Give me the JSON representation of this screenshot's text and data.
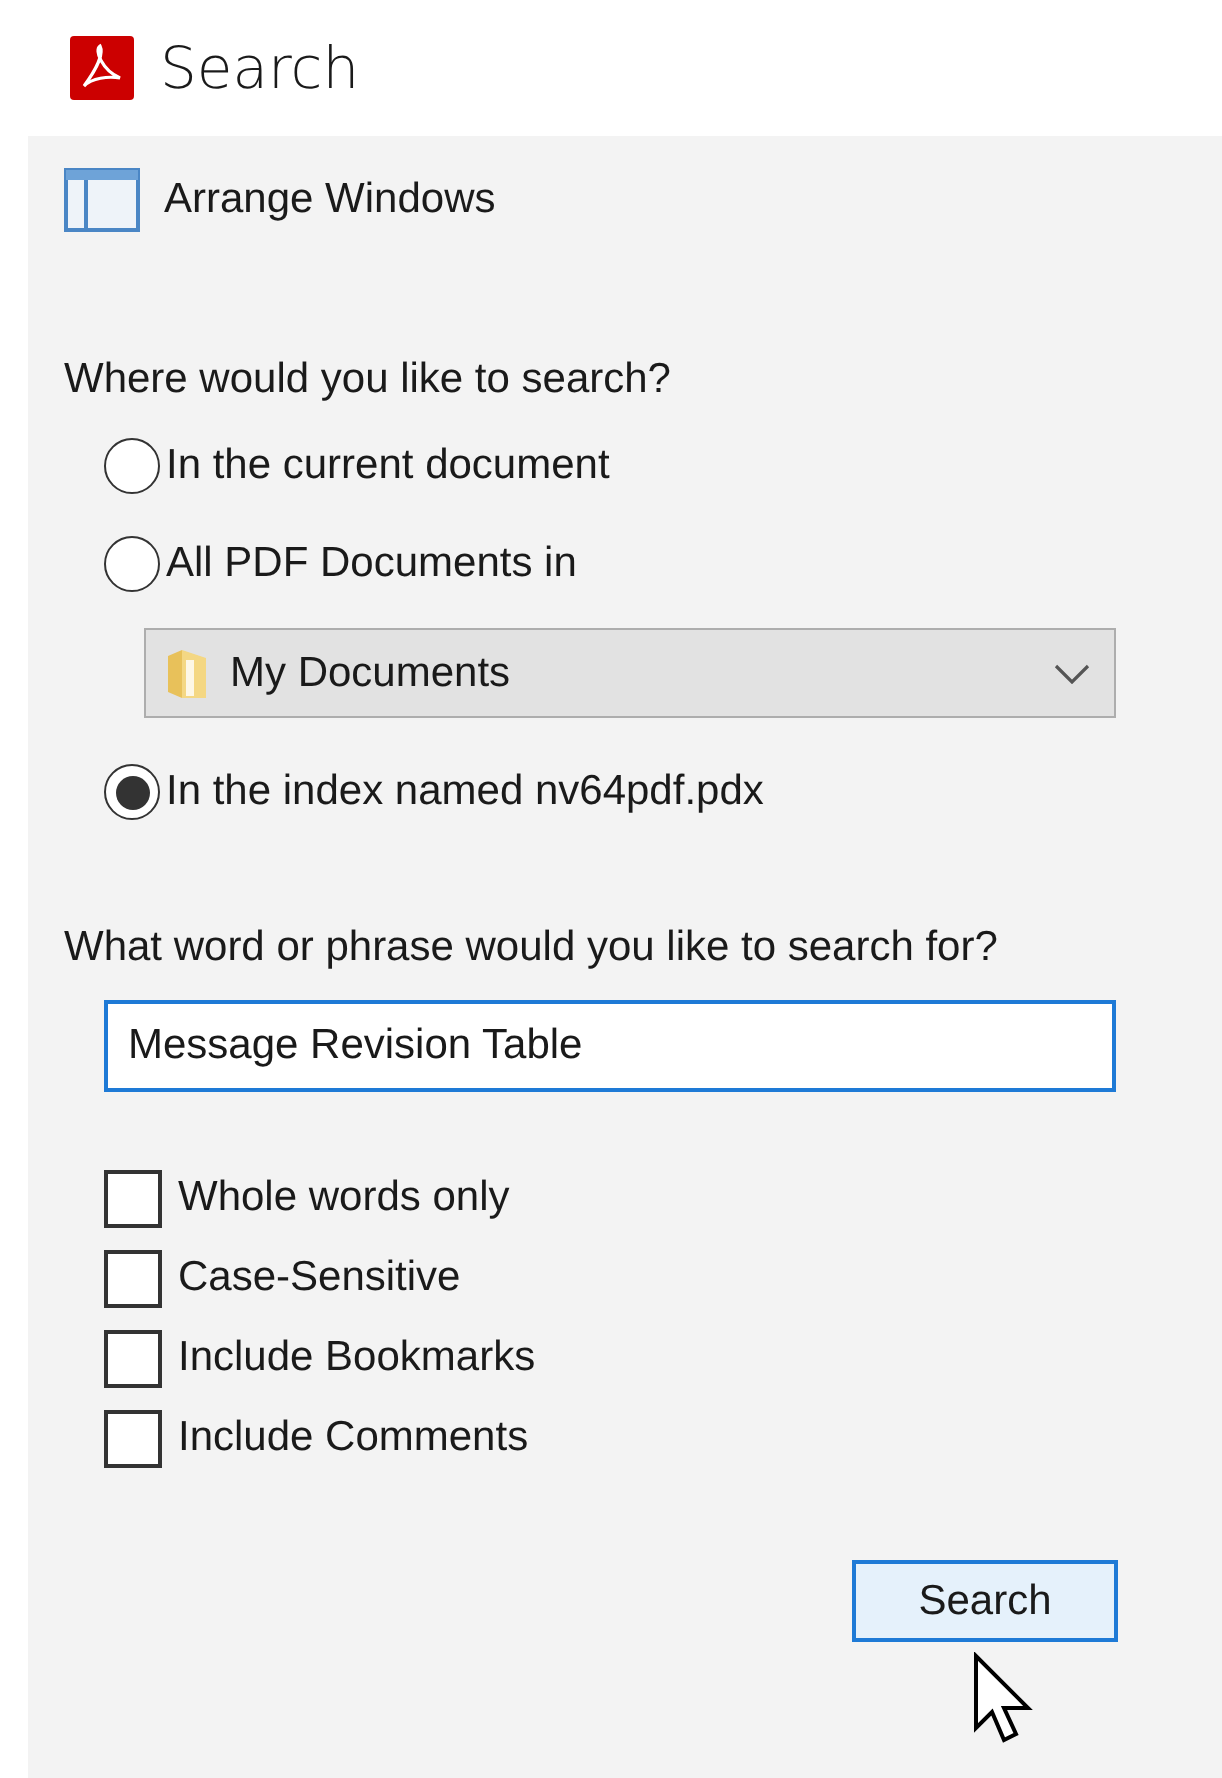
{
  "window": {
    "title": "Search"
  },
  "arrange_windows": {
    "label": "Arrange Windows"
  },
  "location": {
    "question": "Where would you like to search?",
    "options": [
      {
        "kind": "radio",
        "label": "In the current document",
        "selected": false
      },
      {
        "kind": "radio",
        "label": "All PDF Documents in",
        "selected": false
      },
      {
        "kind": "dropdown",
        "value": "My Documents"
      },
      {
        "kind": "radio",
        "label": "In the index named nv64pdf.pdx",
        "selected": true
      }
    ]
  },
  "query": {
    "question": "What word or phrase would you like to search for?",
    "value": "Message Revision Table",
    "focused": true
  },
  "options": [
    {
      "label": "Whole words only",
      "checked": false
    },
    {
      "label": "Case-Sensitive",
      "checked": false
    },
    {
      "label": "Include Bookmarks",
      "checked": false
    },
    {
      "label": "Include Comments",
      "checked": false
    }
  ],
  "search_button": {
    "label": "Search",
    "hovered": true
  }
}
